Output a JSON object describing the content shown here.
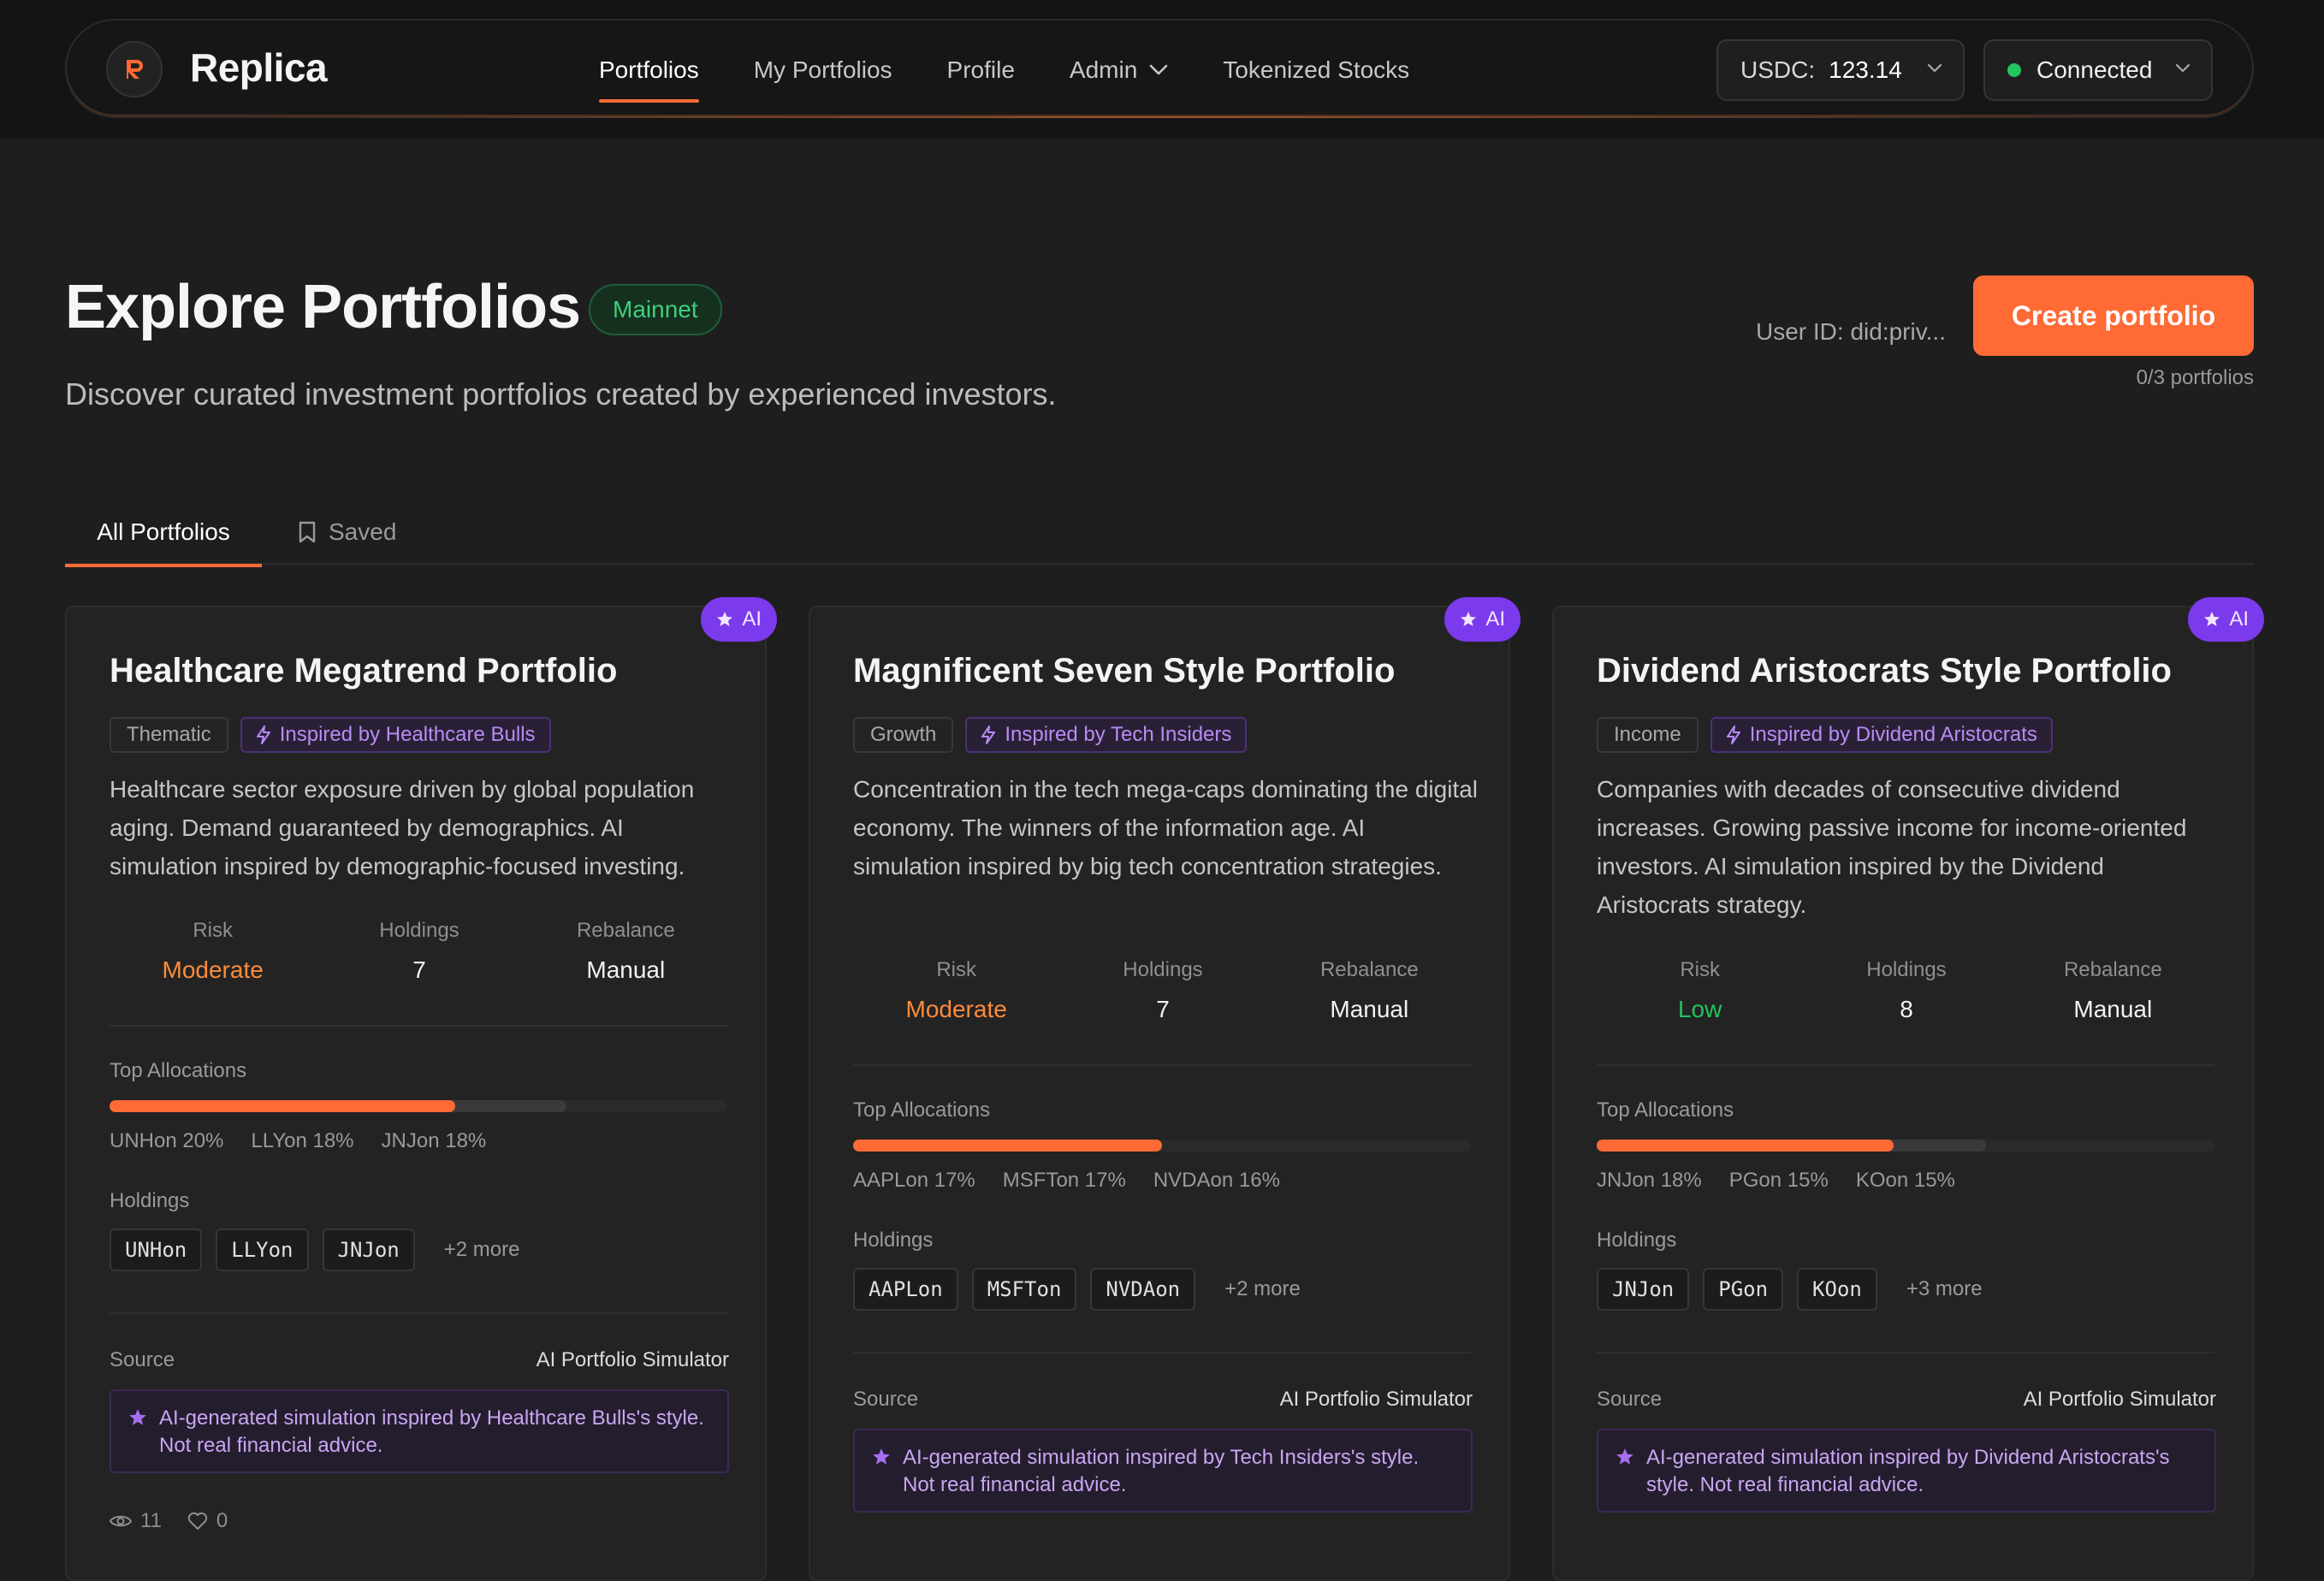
{
  "nav": {
    "brand": "Replica",
    "links": [
      "Portfolios",
      "My Portfolios",
      "Profile",
      "Admin",
      "Tokenized Stocks"
    ],
    "usdc_label": "USDC:",
    "usdc_value": "123.14",
    "wallet_status": "Connected"
  },
  "header": {
    "title": "Explore Portfolios",
    "network_badge": "Mainnet",
    "subtitle": "Discover curated investment portfolios created by experienced investors.",
    "user_id": "User ID: did:priv...",
    "create_button": "Create portfolio",
    "portfolio_count": "0/3 portfolios"
  },
  "tabs": {
    "all": "All Portfolios",
    "saved": "Saved"
  },
  "labels": {
    "ai_badge": "AI",
    "risk": "Risk",
    "holdings": "Holdings",
    "rebalance": "Rebalance",
    "top_allocations": "Top Allocations",
    "holdings_section": "Holdings",
    "source": "Source"
  },
  "cards": [
    {
      "title": "Healthcare Megatrend Portfolio",
      "category": "Thematic",
      "inspired": "Inspired by Healthcare Bulls",
      "description": "Healthcare sector exposure driven by global population aging. Demand guaranteed by demographics. AI simulation inspired by demographic-focused investing.",
      "risk": "Moderate",
      "holdings_count": "7",
      "rebalance": "Manual",
      "allocations": [
        "UNHon 20%",
        "LLYon 18%",
        "JNJon 18%"
      ],
      "alloc_top_fraction": 0.56,
      "alloc_total_fraction": 0.74,
      "chips": [
        "UNHon",
        "LLYon",
        "JNJon"
      ],
      "more": "+2 more",
      "source": "AI Portfolio Simulator",
      "disclaimer": "AI-generated simulation inspired by Healthcare Bulls's style. Not real financial advice.",
      "views": "11",
      "likes": "0"
    },
    {
      "title": "Magnificent Seven Style Portfolio",
      "category": "Growth",
      "inspired": "Inspired by Tech Insiders",
      "description": "Concentration in the tech mega-caps dominating the digital economy. The winners of the information age. AI simulation inspired by big tech concentration strategies.",
      "risk": "Moderate",
      "holdings_count": "7",
      "rebalance": "Manual",
      "allocations": [
        "AAPLon 17%",
        "MSFTon 17%",
        "NVDAon 16%"
      ],
      "alloc_top_fraction": 0.5,
      "alloc_total_fraction": 0.5,
      "chips": [
        "AAPLon",
        "MSFTon",
        "NVDAon"
      ],
      "more": "+2 more",
      "source": "AI Portfolio Simulator",
      "disclaimer": "AI-generated simulation inspired by Tech Insiders's style. Not real financial advice."
    },
    {
      "title": "Dividend Aristocrats Style Portfolio",
      "category": "Income",
      "inspired": "Inspired by Dividend Aristocrats",
      "description": "Companies with decades of consecutive dividend increases. Growing passive income for income-oriented investors. AI simulation inspired by the Dividend Aristocrats strategy.",
      "risk": "Low",
      "holdings_count": "8",
      "rebalance": "Manual",
      "allocations": [
        "JNJon 18%",
        "PGon 15%",
        "KOon 15%"
      ],
      "alloc_top_fraction": 0.48,
      "alloc_total_fraction": 0.63,
      "chips": [
        "JNJon",
        "PGon",
        "KOon"
      ],
      "more": "+3 more",
      "source": "AI Portfolio Simulator",
      "disclaimer": "AI-generated simulation inspired by Dividend Aristocrats's style. Not real financial advice."
    }
  ],
  "colors": {
    "accent": "#ff6a35",
    "ai_purple": "#7c3aed",
    "risk_moderate": "#ff8c3a",
    "risk_low": "#22c55e",
    "mainnet_green": "#3fcf7a"
  },
  "icons": [
    "replica-logo-icon",
    "chevron-down-icon",
    "bookmark-icon",
    "star-icon",
    "lightning-icon",
    "eye-icon",
    "heart-icon"
  ]
}
